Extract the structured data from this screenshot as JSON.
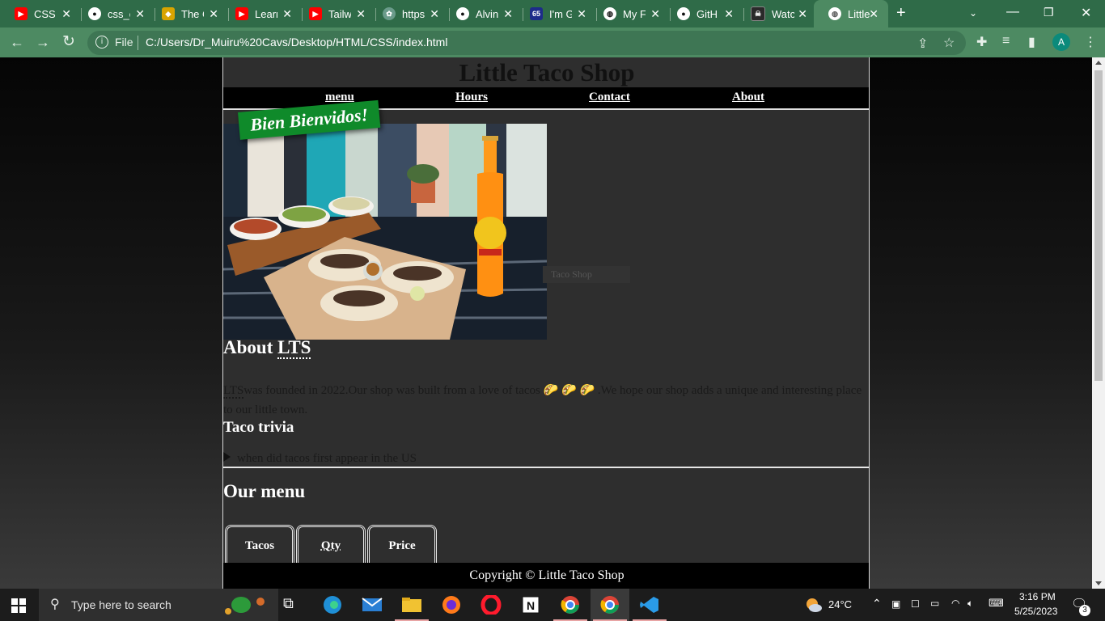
{
  "browser": {
    "tabs": [
      {
        "title": "CSS T",
        "icon": "youtube-icon",
        "color": "#ff0000"
      },
      {
        "title": "css_c",
        "icon": "github-icon",
        "color": "#111111"
      },
      {
        "title": "The C",
        "icon": "site-icon",
        "color": "#d8a400"
      },
      {
        "title": "Learr",
        "icon": "youtube-icon",
        "color": "#ff0000"
      },
      {
        "title": "Tailw",
        "icon": "youtube-icon",
        "color": "#ff0000"
      },
      {
        "title": "https",
        "icon": "chatgpt-icon",
        "color": "#6a9b8a"
      },
      {
        "title": "Alvin",
        "icon": "github-icon",
        "color": "#111111"
      },
      {
        "title": "I'm G",
        "icon": "site-icon-65",
        "color": "#1d2b8a"
      },
      {
        "title": "My F",
        "icon": "globe-icon",
        "color": "#111111"
      },
      {
        "title": "GitH",
        "icon": "github-icon",
        "color": "#111111"
      },
      {
        "title": "Watc",
        "icon": "site-icon",
        "color": "#2a2a2a"
      },
      {
        "title": "Little",
        "icon": "globe-icon",
        "color": "#555555",
        "active": true
      }
    ],
    "fav65": "65",
    "omnibox": {
      "scheme_label": "File",
      "url": "C:/Users/Dr_Muiru%20Cavs/Desktop/HTML/CSS/index.html"
    },
    "profile_initial": "A"
  },
  "page": {
    "site_title": "Little Taco Shop",
    "nav": [
      "menu",
      "Hours",
      "Contact",
      "About"
    ],
    "banner": "Bien Bienvidos!",
    "ghost_caption": "Taco Shop",
    "about_heading_prefix": "About ",
    "about_abbr": "LTS",
    "about_abbr2": "LTS",
    "about_text": "was founded in 2022.Our shop was built from a love of tacos 🌮 🌮 🌮 .We hope our shop adds a unique and interesting place to our little town.",
    "trivia_heading": "Taco trivia",
    "trivia_summary": "when did tacos first appear in the US",
    "menu_heading": "Our menu",
    "table_headers": [
      "Tacos",
      "Qty",
      "Price"
    ],
    "footer": "Copyright © Little Taco Shop"
  },
  "taskbar": {
    "search_placeholder": "Type here to search",
    "weather": "24°C",
    "time": "3:16 PM",
    "date": "5/25/2023",
    "notifications": "3"
  }
}
